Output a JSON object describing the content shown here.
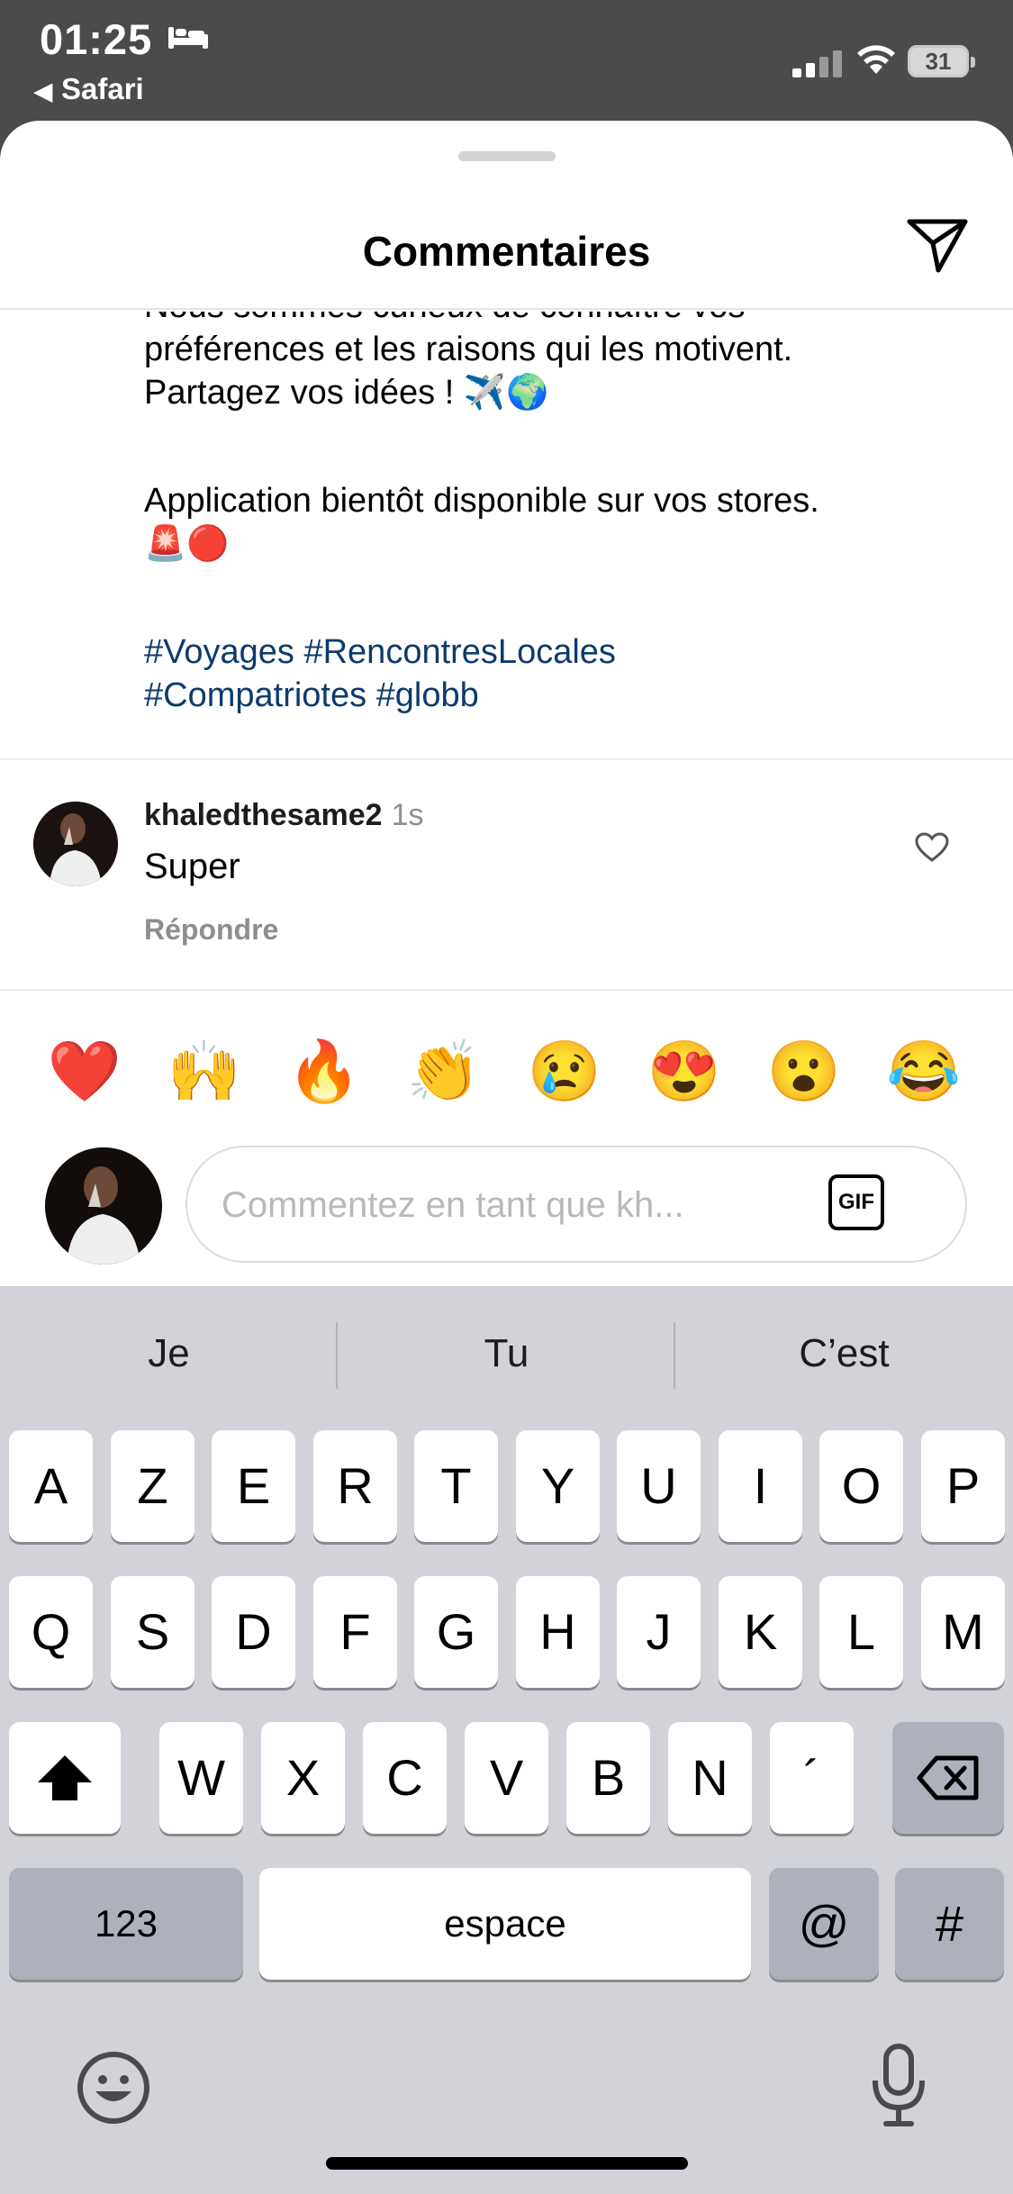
{
  "status_bar": {
    "time": "01:25",
    "back_label": "Safari",
    "battery": "31"
  },
  "header": {
    "title": "Commentaires"
  },
  "post": {
    "cut_line": "Nous sommes curieux de connaître vos",
    "line1": "préférences et les raisons qui les motivent.",
    "line2": "Partagez vos idées ! ✈️🌍",
    "line3": "Application bientôt disponible sur vos stores.",
    "line4": "🚨🔴",
    "tags_line1": "#Voyages #RencontresLocales",
    "tags_line2": "#Compatriotes #globb"
  },
  "comment": {
    "username": "khaledthesame2",
    "time": "1s",
    "text": "Super",
    "reply_label": "Répondre"
  },
  "reactions": [
    "❤️",
    "🙌",
    "🔥",
    "👏",
    "😢",
    "😍",
    "😮",
    "😂"
  ],
  "input": {
    "placeholder": "Commentez en tant que kh...",
    "value": "",
    "gif_label": "GIF"
  },
  "keyboard": {
    "suggestions": [
      "Je",
      "Tu",
      "C’est"
    ],
    "row1": [
      "A",
      "Z",
      "E",
      "R",
      "T",
      "Y",
      "U",
      "I",
      "O",
      "P"
    ],
    "row2": [
      "Q",
      "S",
      "D",
      "F",
      "G",
      "H",
      "J",
      "K",
      "L",
      "M"
    ],
    "row3": [
      "W",
      "X",
      "C",
      "V",
      "B",
      "N",
      "´"
    ],
    "numbers_label": "123",
    "space_label": "espace",
    "at_label": "@",
    "hash_label": "#"
  }
}
